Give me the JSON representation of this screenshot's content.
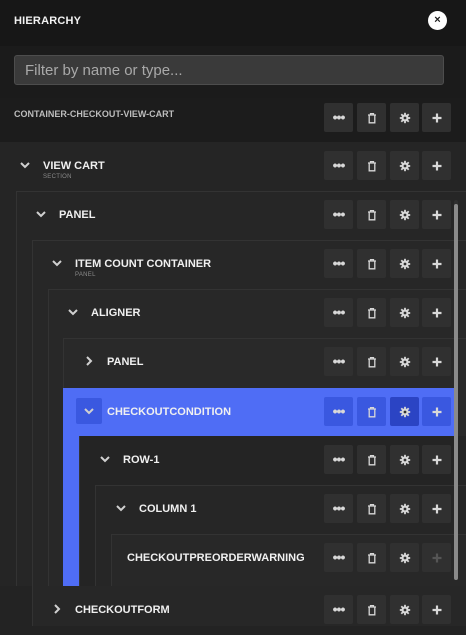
{
  "panel": {
    "title": "HIERARCHY",
    "close_label": "×"
  },
  "filter": {
    "placeholder": "Filter by name or type..."
  },
  "rows": [
    {
      "label": "CONTAINER-CHECKOUT-VIEW-CART",
      "sublabel": "",
      "chevron": "none"
    },
    {
      "label": "VIEW CART",
      "sublabel": "SECTION",
      "chevron": "down"
    },
    {
      "label": "PANEL",
      "sublabel": "",
      "chevron": "down"
    },
    {
      "label": "ITEM COUNT CONTAINER",
      "sublabel": "PANEL",
      "chevron": "down"
    },
    {
      "label": "ALIGNER",
      "sublabel": "",
      "chevron": "down"
    },
    {
      "label": "PANEL",
      "sublabel": "",
      "chevron": "right"
    },
    {
      "label": "CHECKOUTCONDITION",
      "sublabel": "",
      "chevron": "down",
      "selected": true
    },
    {
      "label": "ROW-1",
      "sublabel": "",
      "chevron": "down"
    },
    {
      "label": "COLUMN 1",
      "sublabel": "",
      "chevron": "down"
    },
    {
      "label": "CHECKOUTPREORDERWARNING",
      "sublabel": "",
      "chevron": "none",
      "add_disabled": true
    },
    {
      "label": "CHECKOUTFORM",
      "sublabel": "",
      "chevron": "right"
    }
  ],
  "row_actions": [
    "more-options",
    "delete",
    "settings",
    "add"
  ],
  "colors": {
    "selected": "#4f6df5",
    "header_bg": "#171717",
    "panel_bg": "#232323"
  }
}
